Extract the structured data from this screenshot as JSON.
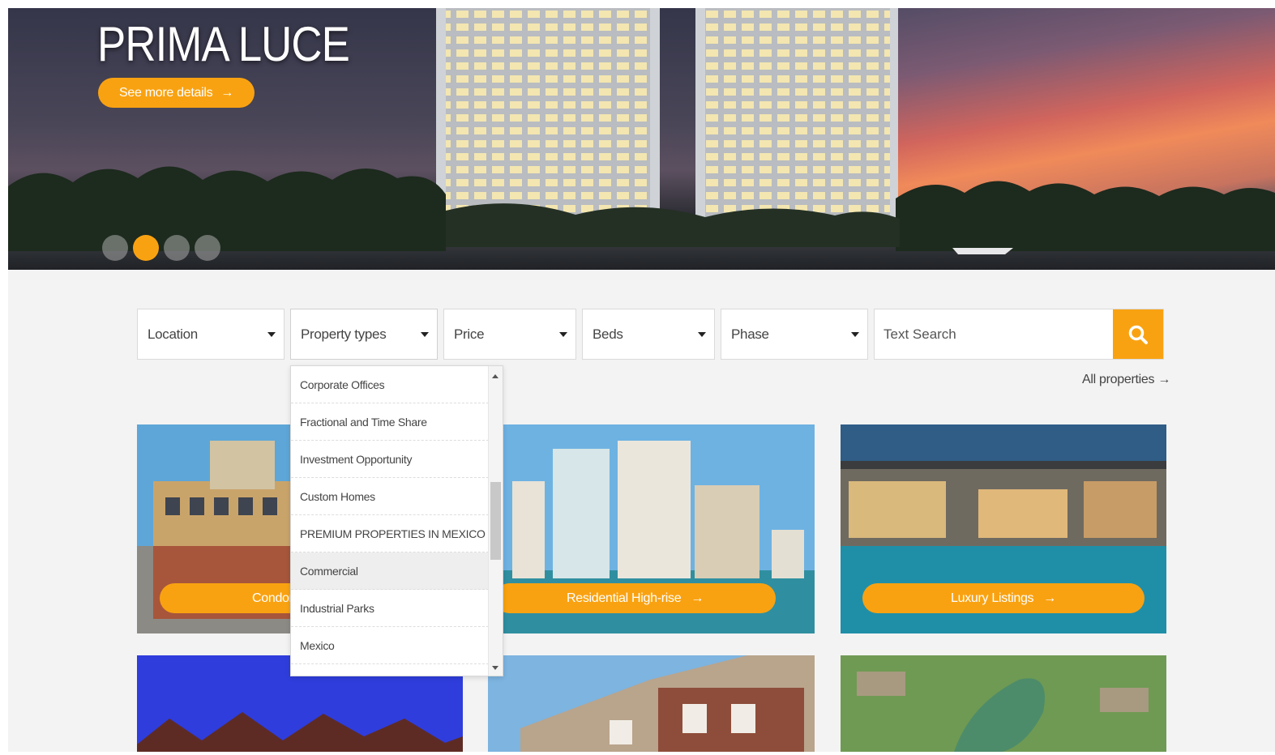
{
  "hero": {
    "title": "PRIMA LUCE",
    "button_label": "See more details",
    "button_arrow": "→",
    "slides": [
      {
        "active": false
      },
      {
        "active": true
      },
      {
        "active": false
      },
      {
        "active": false
      }
    ]
  },
  "filters": {
    "location": "Location",
    "property_types": "Property types",
    "price": "Price",
    "beds": "Beds",
    "phase": "Phase",
    "search_placeholder": "Text Search"
  },
  "all_properties_link": "All properties →",
  "property_types_dropdown": {
    "open": true,
    "highlighted": "Commercial",
    "options": [
      "Corporate Offices",
      "Fractional and Time Share",
      "Investment Opportunity",
      "Custom Homes",
      "PREMIUM PROPERTIES IN MEXICO",
      "Commercial",
      "Industrial Parks",
      "Mexico"
    ]
  },
  "categories": [
    {
      "label": "Condom",
      "arrow": "→"
    },
    {
      "label": "Residential High-rise",
      "arrow": "→"
    },
    {
      "label": "Luxury Listings",
      "arrow": "→"
    }
  ],
  "colors": {
    "accent": "#f9a211",
    "page_bg": "#f3f3f3",
    "text": "#444444"
  },
  "icons": {
    "search": "search-icon",
    "caret": "caret-down-icon",
    "arrow": "arrow-right-icon"
  }
}
